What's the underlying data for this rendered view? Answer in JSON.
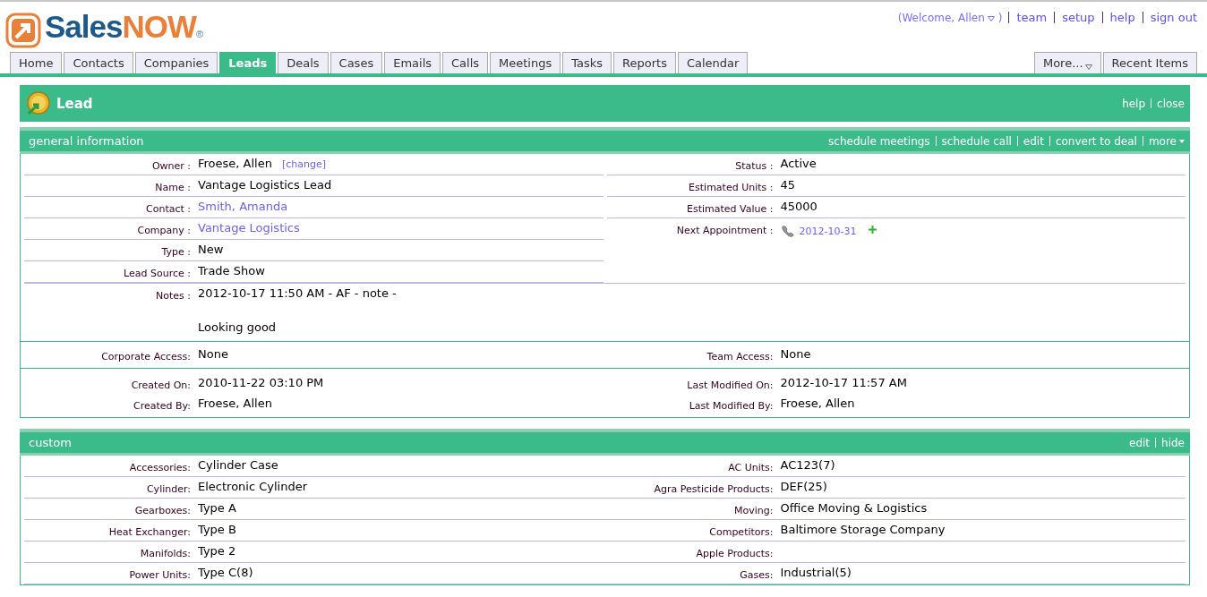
{
  "logo": {
    "text_1": "Sales",
    "text_2": "NOW",
    "mark": "®"
  },
  "top_links": {
    "welcome_open": "(Welcome, Allen",
    "welcome_close": ")",
    "links": [
      "team",
      "setup",
      "help",
      "sign out"
    ]
  },
  "tabs": [
    {
      "label": "Home",
      "selected": false
    },
    {
      "label": "Contacts",
      "selected": false
    },
    {
      "label": "Companies",
      "selected": false
    },
    {
      "label": "Leads",
      "selected": true
    },
    {
      "label": "Deals",
      "selected": false
    },
    {
      "label": "Cases",
      "selected": false
    },
    {
      "label": "Emails",
      "selected": false
    },
    {
      "label": "Calls",
      "selected": false
    },
    {
      "label": "Meetings",
      "selected": false
    },
    {
      "label": "Tasks",
      "selected": false
    },
    {
      "label": "Reports",
      "selected": false
    },
    {
      "label": "Calendar",
      "selected": false
    }
  ],
  "right_tabs": [
    {
      "label": "More...",
      "kind": "menu"
    },
    {
      "label": "Recent Items",
      "kind": "plain"
    }
  ],
  "page_header": {
    "title": "Lead",
    "links": [
      "help",
      "close"
    ]
  },
  "general_information": {
    "title": "general information",
    "actions": [
      {
        "label": "schedule meetings",
        "kind": "plain"
      },
      {
        "label": "schedule call",
        "kind": "plain"
      },
      {
        "label": "edit",
        "kind": "plain"
      },
      {
        "label": "convert to deal",
        "kind": "plain"
      },
      {
        "label": "more",
        "kind": "menu"
      }
    ],
    "left_fields": [
      {
        "label": "Owner :",
        "kind": "owner",
        "value": "Froese, Allen",
        "action": "[change]"
      },
      {
        "label": "Name :",
        "kind": "text",
        "value": "Vantage Logistics Lead"
      },
      {
        "label": "Contact :",
        "kind": "link",
        "value": "Smith, Amanda"
      },
      {
        "label": "Company :",
        "kind": "link",
        "value": "Vantage Logistics"
      },
      {
        "label": "Type :",
        "kind": "text",
        "value": "New"
      },
      {
        "label": "Lead Source :",
        "kind": "text",
        "value": "Trade Show"
      }
    ],
    "right_fields": [
      {
        "label": "Status :",
        "kind": "text",
        "value": "Active"
      },
      {
        "label": "Estimated Units :",
        "kind": "text",
        "value": "45"
      },
      {
        "label": "Estimated Value :",
        "kind": "text",
        "value": "45000"
      },
      {
        "label": "Next Appointment :",
        "kind": "appointment",
        "value": "2012-10-31"
      }
    ],
    "notes": {
      "label": "Notes :",
      "lines": [
        "2012-10-17 11:50 AM - AF - note -",
        "Looking good"
      ]
    },
    "access": [
      {
        "left_label": "Corporate Access:",
        "left_value": "None",
        "right_label": "Team Access:",
        "right_value": "None"
      }
    ],
    "audit": [
      {
        "left_label": "Created On:",
        "left_value": "2010-11-22 03:10 PM",
        "right_label": "Last Modified On:",
        "right_value": "2012-10-17 11:57 AM"
      },
      {
        "left_label": "Created By:",
        "left_value": "Froese, Allen",
        "right_label": "Last Modified By:",
        "right_value": "Froese, Allen"
      }
    ]
  },
  "custom": {
    "title": "custom",
    "actions": [
      {
        "label": "edit",
        "kind": "plain"
      },
      {
        "label": "hide",
        "kind": "plain"
      }
    ],
    "rows": [
      {
        "left_label": "Accessories:",
        "left_value": "Cylinder Case",
        "right_label": "AC Units:",
        "right_value": "AC123(7)"
      },
      {
        "left_label": "Cylinder:",
        "left_value": "Electronic Cylinder",
        "right_label": "Agra Pesticide Products:",
        "right_value": "DEF(25)"
      },
      {
        "left_label": "Gearboxes:",
        "left_value": "Type A",
        "right_label": "Moving:",
        "right_value": "Office Moving & Logistics"
      },
      {
        "left_label": "Heat Exchanger:",
        "left_value": "Type B",
        "right_label": "Competitors:",
        "right_value": "Baltimore Storage Company"
      },
      {
        "left_label": "Manifolds:",
        "left_value": "Type 2",
        "right_label": "Apple Products:"
      },
      {
        "left_label": "Power Units:",
        "left_value": "Type C(8)",
        "right_label": "Gases:",
        "right_value": "Industrial(5)"
      }
    ]
  }
}
